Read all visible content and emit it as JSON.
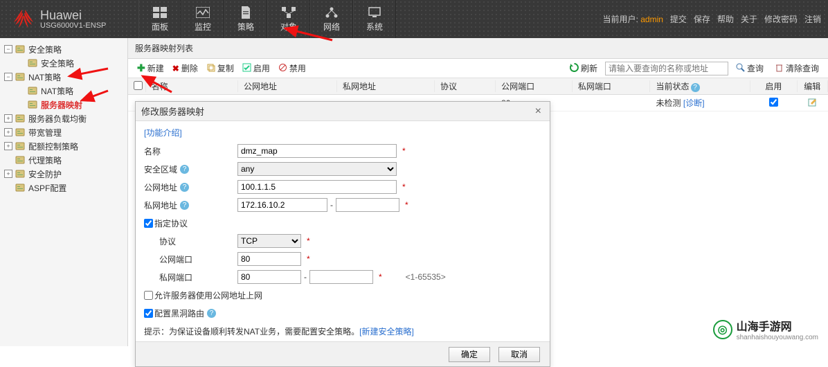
{
  "header": {
    "brand": "Huawei",
    "model": "USG6000V1-ENSP",
    "tabs": [
      "面板",
      "监控",
      "策略",
      "对象",
      "网络",
      "系统"
    ],
    "cur_user_label": "当前用户:",
    "cur_user": "admin",
    "actions": [
      "提交",
      "保存",
      "帮助",
      "关于",
      "修改密码",
      "注销"
    ]
  },
  "sidebar": {
    "items": [
      {
        "toggle": "minus",
        "indent": 0,
        "label": "安全策略"
      },
      {
        "toggle": "",
        "indent": 1,
        "label": "安全策略"
      },
      {
        "toggle": "minus",
        "indent": 0,
        "label": "NAT策略"
      },
      {
        "toggle": "",
        "indent": 1,
        "label": "NAT策略"
      },
      {
        "toggle": "",
        "indent": 1,
        "label": "服务器映射",
        "sel": true
      },
      {
        "toggle": "plus",
        "indent": 0,
        "label": "服务器负载均衡"
      },
      {
        "toggle": "plus",
        "indent": 0,
        "label": "带宽管理"
      },
      {
        "toggle": "plus",
        "indent": 0,
        "label": "配额控制策略"
      },
      {
        "toggle": "",
        "indent": 0,
        "noTog": true,
        "label": "代理策略"
      },
      {
        "toggle": "plus",
        "indent": 0,
        "label": "安全防护"
      },
      {
        "toggle": "",
        "indent": 0,
        "noTog": true,
        "label": "ASPF配置"
      }
    ]
  },
  "panel": {
    "title": "服务器映射列表",
    "toolbar": {
      "new": "新建",
      "del": "删除",
      "copy": "复制",
      "enable": "启用",
      "disable": "禁用",
      "refresh": "刷新",
      "search_ph": "请输入要查询的名称或地址",
      "query": "查询",
      "clear": "清除查询"
    },
    "cols": [
      "",
      "名称",
      "公网地址",
      "私网地址",
      "协议",
      "公网端口",
      "私网端口",
      "当前状态",
      "启用",
      "编辑"
    ],
    "row": {
      "pport": "80",
      "status": "未检测",
      "diag": "[诊断]",
      "enabled": true
    }
  },
  "dialog": {
    "title": "修改服务器映射",
    "func_link": "[功能介绍]",
    "fields": {
      "name_label": "名称",
      "name_val": "dmz_map",
      "zone_label": "安全区域",
      "zone_val": "any",
      "pubip_label": "公网地址",
      "pubip_val": "100.1.1.5",
      "privip_label": "私网地址",
      "privip_val": "172.16.10.2",
      "proto_chk_label": "指定协议",
      "proto_label": "协议",
      "proto_val": "TCP",
      "pport_label": "公网端口",
      "pport_val": "80",
      "sport_label": "私网端口",
      "sport_val": "80",
      "sport_hint": "<1-65535>",
      "allow_surf": "允许服务器使用公网地址上网",
      "blackhole": "配置黑洞路由"
    },
    "tip_prefix": "提示：为保证设备顺利转发NAT业务，需要配置安全策略。",
    "tip_link": "[新建安全策略]",
    "ok": "确定",
    "cancel": "取消"
  },
  "watermark": {
    "t1": "山海手游网",
    "t2": "shanhaishouyouwang.com"
  }
}
